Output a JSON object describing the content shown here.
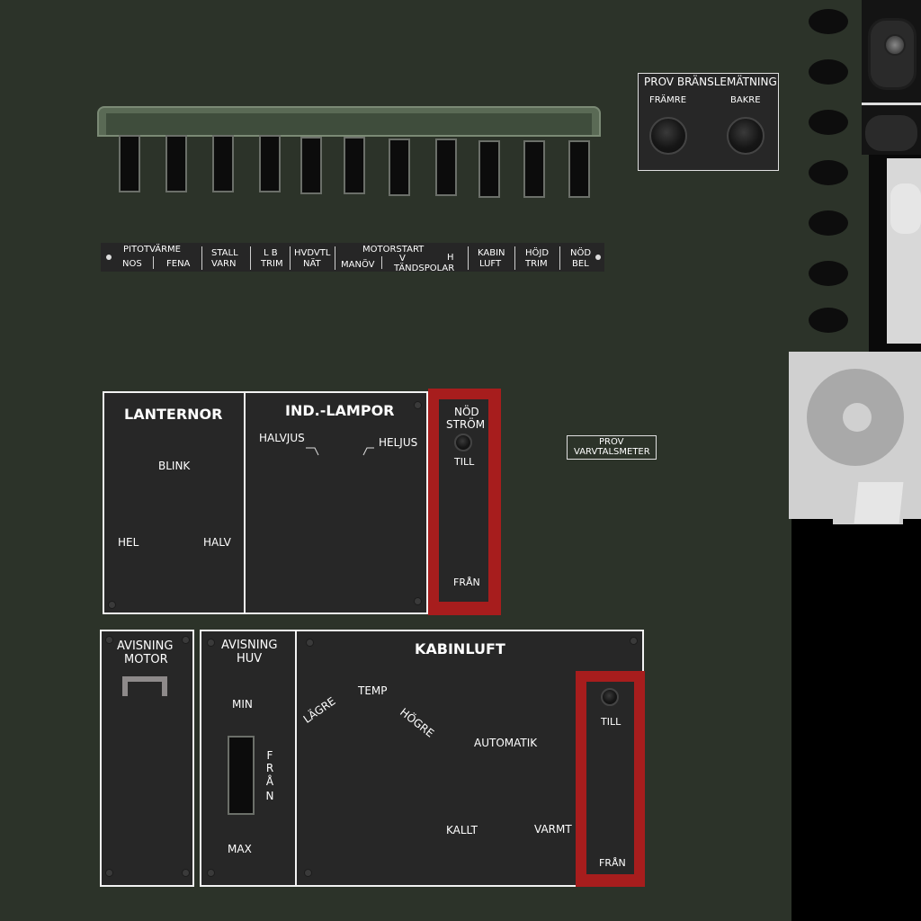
{
  "fuel_test": {
    "title": "PROV BRÄNSLEMÄTNING",
    "front": "FRÄMRE",
    "rear": "BAKRE"
  },
  "breaker_labels": {
    "pitot_title": "PITOTVÄRME",
    "pitot_nose": "NOS",
    "pitot_fin": "FENA",
    "stall_1": "STALL",
    "stall_2": "VARN",
    "lb_1": "L B",
    "lb_2": "TRIM",
    "hvdvtl_1": "HVDVTL",
    "hvdvtl_2": "NÄT",
    "motorstart_title": "MOTORSTART",
    "manov": "MANÖV",
    "v": "V",
    "h": "H",
    "tandspolar": "TÄNDSPOLAR",
    "kabin_1": "KABIN",
    "kabin_2": "LUFT",
    "hojd_1": "HÖJD",
    "hojd_2": "TRIM",
    "nod_1": "NÖD",
    "nod_2": "BEL"
  },
  "prov_varvtalsmeter": {
    "line1": "PROV",
    "line2": "VARVTALSMETER"
  },
  "lanternor": {
    "title": "LANTERNOR",
    "blink": "BLINK",
    "hel": "HEL",
    "halv": "HALV"
  },
  "ind_lampor": {
    "title": "IND.-LAMPOR",
    "halvjus": "HALVJUS",
    "heljus": "HELJUS"
  },
  "nod_strom": {
    "line1": "NÖD",
    "line2": "STRÖM",
    "on": "TILL",
    "off": "FRÅN"
  },
  "avisning_motor": {
    "line1": "AVISNING",
    "line2": "MOTOR"
  },
  "avisning_huv": {
    "line1": "AVISNING",
    "line2": "HUV",
    "min": "MIN",
    "max": "MAX",
    "off": [
      "F",
      "R",
      "Å",
      "N"
    ]
  },
  "kabinluft": {
    "title": "KABINLUFT",
    "temp": "TEMP",
    "lower": "LÄGRE",
    "higher": "HÖGRE",
    "auto": "AUTOMATIK",
    "cold": "KALLT",
    "warm": "VARMT",
    "on": "TILL",
    "off": "FRÅN"
  },
  "colors": {
    "background": "#2c3329",
    "panel": "#272727",
    "guard_red": "#a71d1d",
    "light_gray": "#d0d0d0"
  }
}
